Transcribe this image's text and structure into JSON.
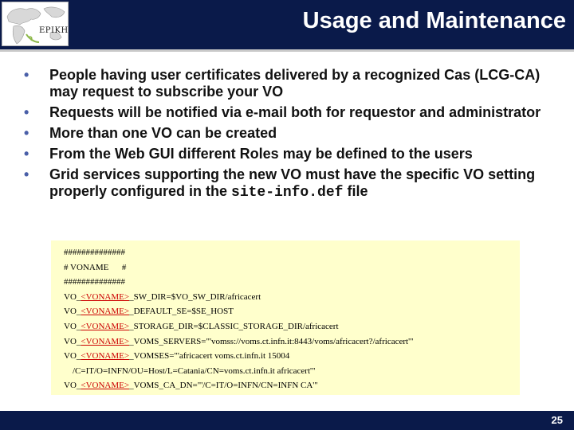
{
  "header": {
    "title": "Usage and Maintenance",
    "logo_text": "EPIKH"
  },
  "bullets": [
    {
      "text": "People having user certificates delivered by a recognized Cas (LCG-CA) may request to subscribe your VO"
    },
    {
      "text": "Requests will be notified via e-mail both for requestor and administrator"
    },
    {
      "text": "More than one VO can be created"
    },
    {
      "text": "From the Web GUI different Roles may be defined to the users"
    },
    {
      "text_before": "Grid services supporting the new VO must have the specific VO setting properly configured in the ",
      "code": "site-info.def",
      "text_after": " file"
    }
  ],
  "bullet_symbol": "•",
  "code_block": {
    "lines": [
      {
        "text": "##############"
      },
      {
        "text": "# VONAME      #"
      },
      {
        "text": "##############"
      },
      {
        "prefix": "VO_",
        "var": "<VONAME>",
        "suffix": "_SW_DIR=$VO_SW_DIR/africacert"
      },
      {
        "prefix": "VO_",
        "var": "<VONAME>",
        "suffix": "_DEFAULT_SE=$SE_HOST"
      },
      {
        "prefix": "VO_",
        "var": "<VONAME>",
        "suffix": "_STORAGE_DIR=$CLASSIC_STORAGE_DIR/africacert"
      },
      {
        "prefix": "VO_",
        "var": "<VONAME>",
        "suffix": "_VOMS_SERVERS=\"'vomss://voms.ct.infn.it:8443/voms/africacert?/africacert'\""
      },
      {
        "prefix": "VO_",
        "var": "<VONAME>",
        "suffix": "_VOMSES=\"'africacert voms.ct.infn.it 15004"
      },
      {
        "text": "    /C=IT/O=INFN/OU=Host/L=Catania/CN=voms.ct.infn.it africacert'\""
      },
      {
        "prefix": "VO_",
        "var": "<VONAME>",
        "suffix": "_VOMS_CA_DN=\"'/C=IT/O=INFN/CN=INFN CA'\""
      }
    ]
  },
  "footer": {
    "page_number": "25"
  },
  "colors": {
    "header_bg": "#0a1a4a",
    "code_bg": "#ffffcc",
    "variable": "#cc0000",
    "bullet": "#4a5fa8"
  }
}
